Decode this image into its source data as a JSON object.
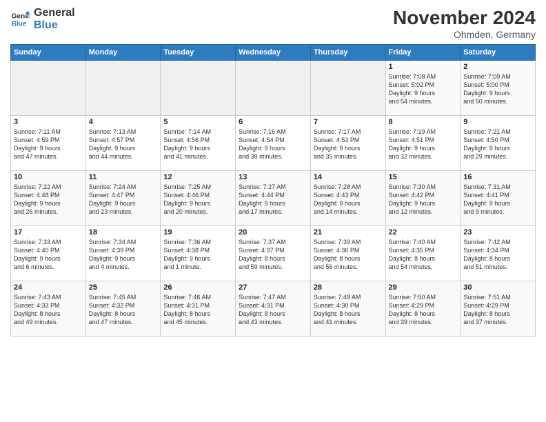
{
  "logo": {
    "line1": "General",
    "line2": "Blue"
  },
  "title": "November 2024",
  "location": "Ohmden, Germany",
  "days_of_week": [
    "Sunday",
    "Monday",
    "Tuesday",
    "Wednesday",
    "Thursday",
    "Friday",
    "Saturday"
  ],
  "weeks": [
    [
      {
        "day": "",
        "info": ""
      },
      {
        "day": "",
        "info": ""
      },
      {
        "day": "",
        "info": ""
      },
      {
        "day": "",
        "info": ""
      },
      {
        "day": "",
        "info": ""
      },
      {
        "day": "1",
        "info": "Sunrise: 7:08 AM\nSunset: 5:02 PM\nDaylight: 9 hours\nand 54 minutes."
      },
      {
        "day": "2",
        "info": "Sunrise: 7:09 AM\nSunset: 5:00 PM\nDaylight: 9 hours\nand 50 minutes."
      }
    ],
    [
      {
        "day": "3",
        "info": "Sunrise: 7:11 AM\nSunset: 4:59 PM\nDaylight: 9 hours\nand 47 minutes."
      },
      {
        "day": "4",
        "info": "Sunrise: 7:13 AM\nSunset: 4:57 PM\nDaylight: 9 hours\nand 44 minutes."
      },
      {
        "day": "5",
        "info": "Sunrise: 7:14 AM\nSunset: 4:56 PM\nDaylight: 9 hours\nand 41 minutes."
      },
      {
        "day": "6",
        "info": "Sunrise: 7:16 AM\nSunset: 4:54 PM\nDaylight: 9 hours\nand 38 minutes."
      },
      {
        "day": "7",
        "info": "Sunrise: 7:17 AM\nSunset: 4:53 PM\nDaylight: 9 hours\nand 35 minutes."
      },
      {
        "day": "8",
        "info": "Sunrise: 7:19 AM\nSunset: 4:51 PM\nDaylight: 9 hours\nand 32 minutes."
      },
      {
        "day": "9",
        "info": "Sunrise: 7:21 AM\nSunset: 4:50 PM\nDaylight: 9 hours\nand 29 minutes."
      }
    ],
    [
      {
        "day": "10",
        "info": "Sunrise: 7:22 AM\nSunset: 4:48 PM\nDaylight: 9 hours\nand 26 minutes."
      },
      {
        "day": "11",
        "info": "Sunrise: 7:24 AM\nSunset: 4:47 PM\nDaylight: 9 hours\nand 23 minutes."
      },
      {
        "day": "12",
        "info": "Sunrise: 7:25 AM\nSunset: 4:46 PM\nDaylight: 9 hours\nand 20 minutes."
      },
      {
        "day": "13",
        "info": "Sunrise: 7:27 AM\nSunset: 4:44 PM\nDaylight: 9 hours\nand 17 minutes."
      },
      {
        "day": "14",
        "info": "Sunrise: 7:28 AM\nSunset: 4:43 PM\nDaylight: 9 hours\nand 14 minutes."
      },
      {
        "day": "15",
        "info": "Sunrise: 7:30 AM\nSunset: 4:42 PM\nDaylight: 9 hours\nand 12 minutes."
      },
      {
        "day": "16",
        "info": "Sunrise: 7:31 AM\nSunset: 4:41 PM\nDaylight: 9 hours\nand 9 minutes."
      }
    ],
    [
      {
        "day": "17",
        "info": "Sunrise: 7:33 AM\nSunset: 4:40 PM\nDaylight: 9 hours\nand 6 minutes."
      },
      {
        "day": "18",
        "info": "Sunrise: 7:34 AM\nSunset: 4:39 PM\nDaylight: 9 hours\nand 4 minutes."
      },
      {
        "day": "19",
        "info": "Sunrise: 7:36 AM\nSunset: 4:38 PM\nDaylight: 9 hours\nand 1 minute."
      },
      {
        "day": "20",
        "info": "Sunrise: 7:37 AM\nSunset: 4:37 PM\nDaylight: 8 hours\nand 59 minutes."
      },
      {
        "day": "21",
        "info": "Sunrise: 7:39 AM\nSunset: 4:36 PM\nDaylight: 8 hours\nand 56 minutes."
      },
      {
        "day": "22",
        "info": "Sunrise: 7:40 AM\nSunset: 4:35 PM\nDaylight: 8 hours\nand 54 minutes."
      },
      {
        "day": "23",
        "info": "Sunrise: 7:42 AM\nSunset: 4:34 PM\nDaylight: 8 hours\nand 51 minutes."
      }
    ],
    [
      {
        "day": "24",
        "info": "Sunrise: 7:43 AM\nSunset: 4:33 PM\nDaylight: 8 hours\nand 49 minutes."
      },
      {
        "day": "25",
        "info": "Sunrise: 7:45 AM\nSunset: 4:32 PM\nDaylight: 8 hours\nand 47 minutes."
      },
      {
        "day": "26",
        "info": "Sunrise: 7:46 AM\nSunset: 4:31 PM\nDaylight: 8 hours\nand 45 minutes."
      },
      {
        "day": "27",
        "info": "Sunrise: 7:47 AM\nSunset: 4:31 PM\nDaylight: 8 hours\nand 43 minutes."
      },
      {
        "day": "28",
        "info": "Sunrise: 7:49 AM\nSunset: 4:30 PM\nDaylight: 8 hours\nand 41 minutes."
      },
      {
        "day": "29",
        "info": "Sunrise: 7:50 AM\nSunset: 4:29 PM\nDaylight: 8 hours\nand 39 minutes."
      },
      {
        "day": "30",
        "info": "Sunrise: 7:51 AM\nSunset: 4:29 PM\nDaylight: 8 hours\nand 37 minutes."
      }
    ]
  ]
}
